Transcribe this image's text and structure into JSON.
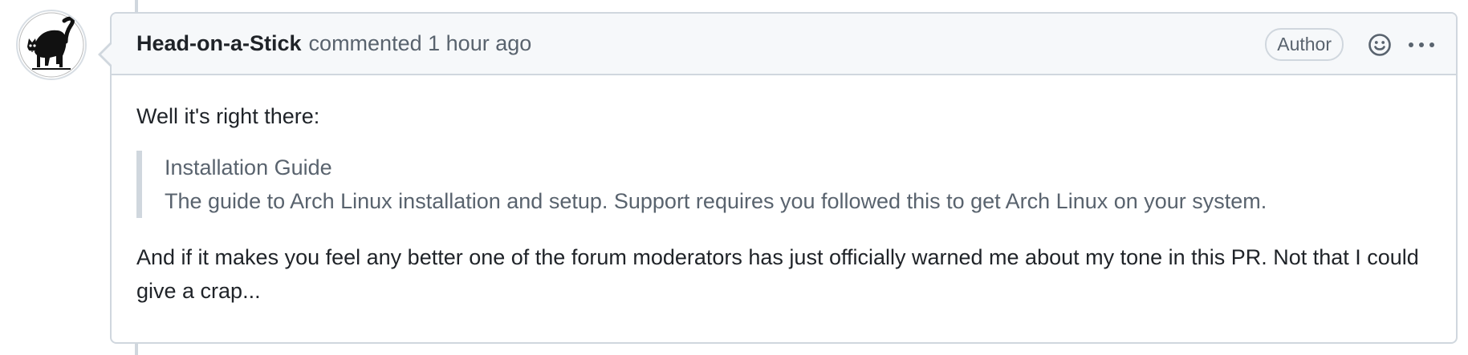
{
  "comment": {
    "author": "Head-on-a-Stick",
    "action": "commented",
    "timestamp": "1 hour ago",
    "badge": "Author",
    "icons": {
      "avatar": "black-cat-avatar",
      "reaction": "smiley-icon",
      "menu": "kebab-horizontal-icon"
    },
    "body": {
      "paragraph1": "Well it's right there:",
      "quote": {
        "title": "Installation Guide",
        "description": "The guide to Arch Linux installation and setup. Support requires you followed this to get Arch Linux on your system."
      },
      "paragraph2": "And if it makes you feel any better one of the forum moderators has just officially warned me about my tone in this PR. Not that I could give a crap..."
    }
  },
  "colors": {
    "border": "#d0d7de",
    "header_bg": "#f6f8fa",
    "muted_text": "#59636e",
    "text": "#1f2328"
  }
}
